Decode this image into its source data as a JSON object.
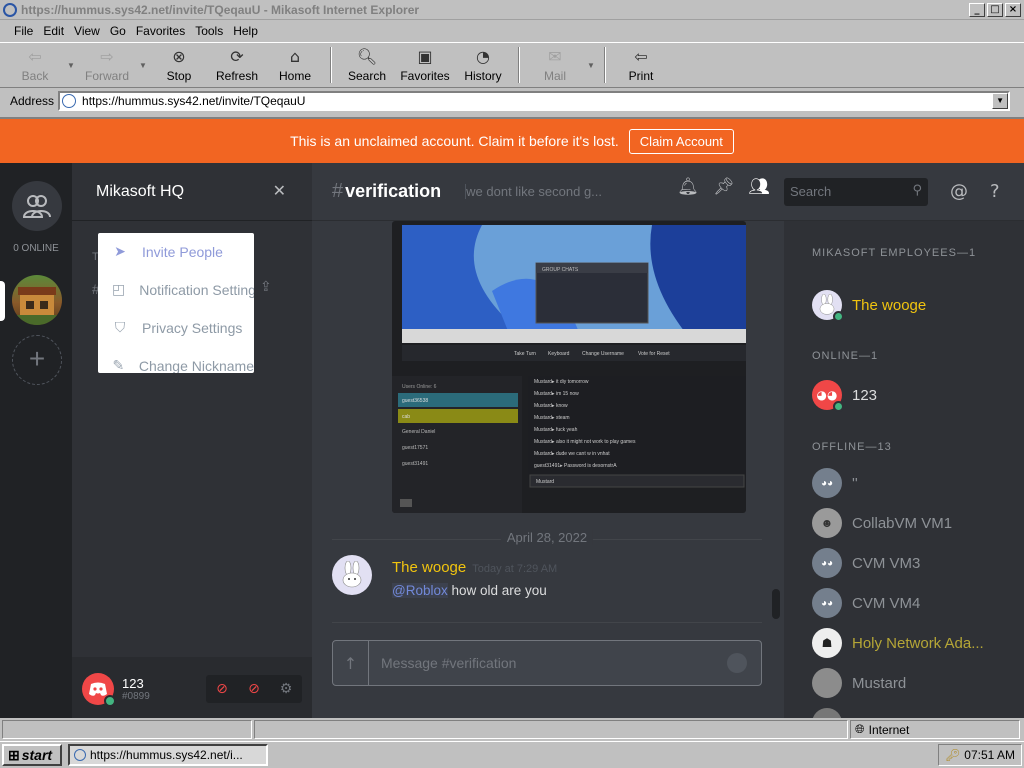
{
  "window": {
    "title": "https://hummus.sys42.net/invite/TQeqauU - Mikasoft Internet Explorer",
    "controls": {
      "minimize": "_",
      "maximize": "□",
      "close": "×"
    }
  },
  "menu": {
    "items": [
      {
        "label": "File"
      },
      {
        "label": "Edit"
      },
      {
        "label": "View"
      },
      {
        "label": "Go"
      },
      {
        "label": "Favorites"
      },
      {
        "label": "Tools"
      },
      {
        "label": "Help"
      }
    ]
  },
  "toolbar": {
    "back": "Back",
    "forward": "Forward",
    "stop": "Stop",
    "refresh": "Refresh",
    "home": "Home",
    "search": "Search",
    "favorites": "Favorites",
    "history": "History",
    "mail": "Mail",
    "print": "Print"
  },
  "address": {
    "label": "Address",
    "url": "https://hummus.sys42.net/invite/TQeqauU"
  },
  "banner": {
    "text": "This is an unclaimed account. Claim it before it's lost.",
    "button": "Claim Account"
  },
  "guilds": {
    "online_count": "0 ONLINE"
  },
  "server": {
    "name": "Mikasoft HQ",
    "close_glyph": "✕",
    "hint_t": "T",
    "hint_hash": "#"
  },
  "server_menu": {
    "items": [
      {
        "label": "Invite People",
        "icon": "send-icon"
      },
      {
        "label": "Notification Settings",
        "icon": "bell-icon"
      },
      {
        "label": "Privacy Settings",
        "icon": "shield-icon"
      },
      {
        "label": "Change Nickname",
        "icon": "pencil-icon"
      }
    ]
  },
  "user": {
    "name": "123",
    "discriminator": "#0899"
  },
  "channel": {
    "name": "verification",
    "hash": "#",
    "topic": "we dont like second g..."
  },
  "search": {
    "placeholder": "Search"
  },
  "messages": {
    "date_divider": "April 28, 2022",
    "items": [
      {
        "author": "The wooge",
        "timestamp": "Today at 7:29 AM",
        "mention": "@Roblox",
        "text": " how old are you"
      }
    ]
  },
  "composer": {
    "placeholder": "Message #verification"
  },
  "members": {
    "categories": [
      {
        "label": "MIKASOFT EMPLOYEES—1"
      },
      {
        "label": "ONLINE—1"
      },
      {
        "label": "OFFLINE—13"
      }
    ],
    "employees": [
      {
        "name": "The wooge"
      }
    ],
    "online": [
      {
        "name": "123"
      }
    ],
    "offline": [
      {
        "name": "''"
      },
      {
        "name": "CollabVM VM1"
      },
      {
        "name": "CVM VM3"
      },
      {
        "name": "CVM VM4"
      },
      {
        "name": "Holy Network Ada..."
      },
      {
        "name": "Mustard"
      }
    ]
  },
  "embed_screenshot": {
    "header": "GROUP CHATS",
    "toolbar": [
      "Take Turn",
      "Keyboard",
      "Change Username",
      "Vote for Reset"
    ],
    "users_title": "Users Online: 6",
    "users": [
      "guest36538",
      "cab",
      "General Daniel",
      "guest17571",
      "guest31491"
    ],
    "chat": [
      "Mustard▸ it diy tomorrow",
      "Mustard▸ im 15 now",
      "Mustard▸ know",
      "Mustard▸ steam",
      "Mustard▸ fuck yeah",
      "Mustard▸ also it might not work to play games",
      "Mustard▸ dude we cant w in vnhat",
      "guest31491▸ Password is desornstrA"
    ],
    "chat_input_user": "Mustard"
  },
  "status": {
    "zone": "Internet"
  },
  "taskbar": {
    "start": "start",
    "task": "https://hummus.sys42.net/i...",
    "clock": "07:51 AM"
  }
}
